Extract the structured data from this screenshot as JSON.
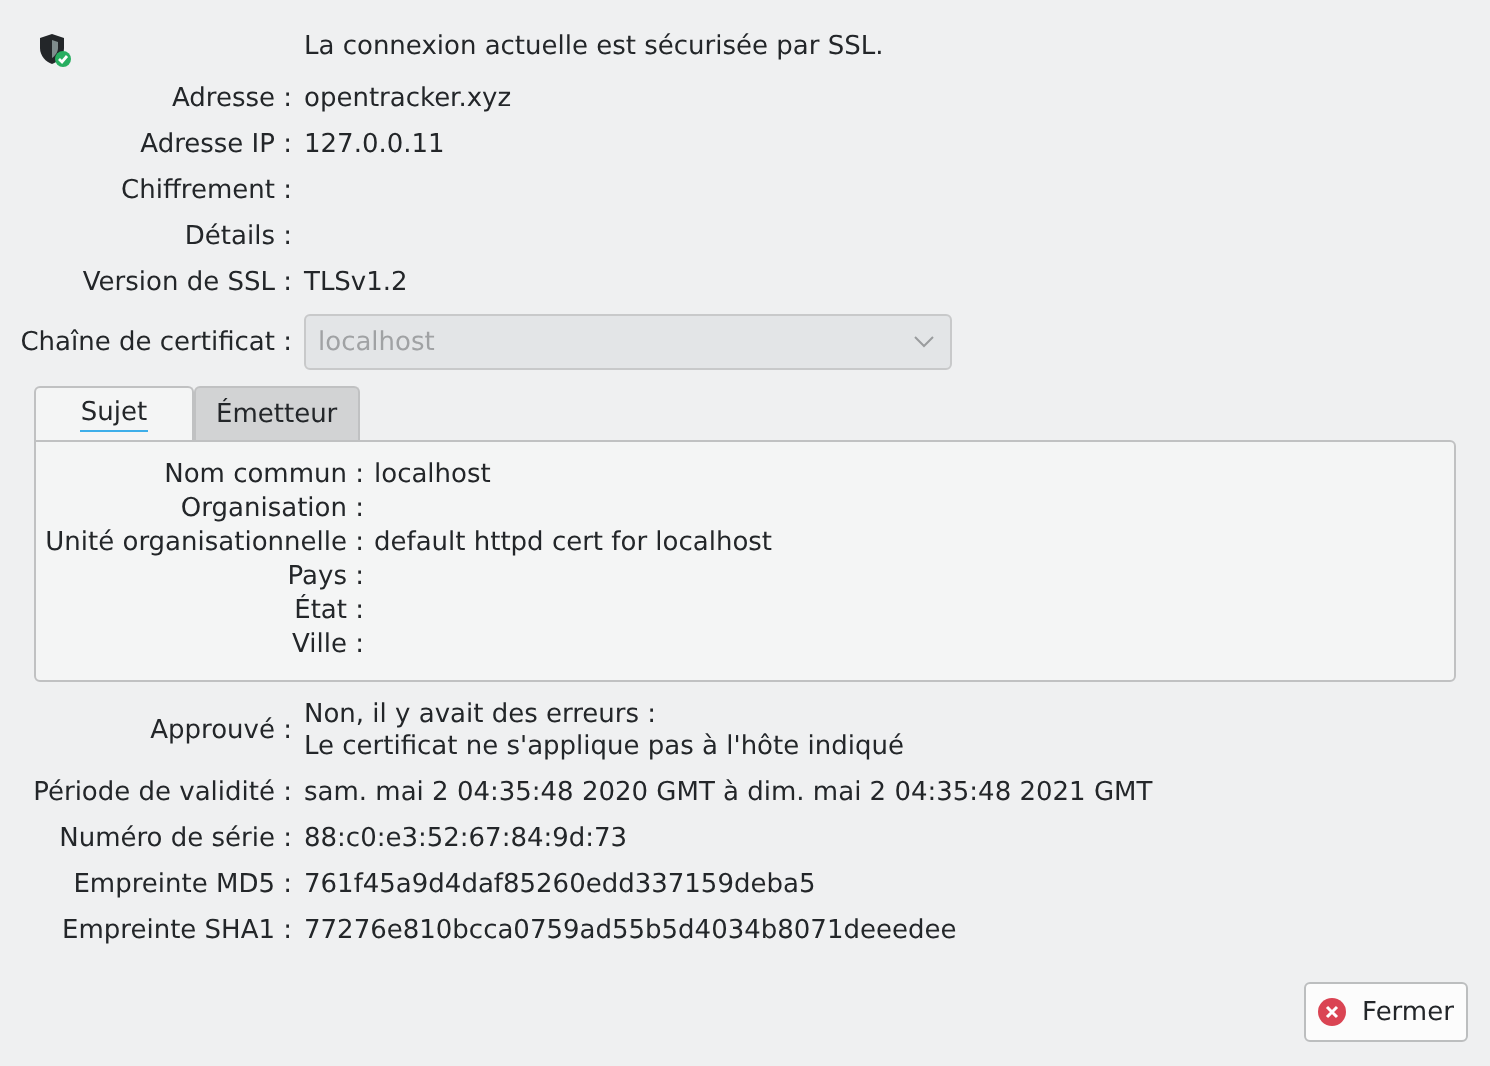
{
  "header": "La connexion actuelle est sécurisée par SSL.",
  "fields": [
    {
      "label": "Adresse :",
      "value": "opentracker.xyz"
    },
    {
      "label": "Adresse IP :",
      "value": "127.0.0.11"
    },
    {
      "label": "Chiffrement :"
    },
    {
      "label": "Détails :"
    },
    {
      "label": "Version de SSL :",
      "value": "TLSv1.2"
    }
  ],
  "chain": {
    "label": "Chaîne de certificat :",
    "value": "localhost",
    "disabled": true
  },
  "tabs": [
    {
      "label": "Sujet",
      "selected": true
    },
    {
      "label": "Émetteur",
      "selected": false
    }
  ],
  "subject": [
    {
      "label": "Nom commun :",
      "value": "localhost"
    },
    {
      "label": "Organisation :"
    },
    {
      "label": "Unité organisationnelle :",
      "value": "default httpd cert for localhost"
    },
    {
      "label": "Pays :"
    },
    {
      "label": "État :"
    },
    {
      "label": "Ville :"
    }
  ],
  "details": [
    {
      "label": "Approuvé :",
      "lines": [
        "Non, il y avait des erreurs :",
        "Le certificat ne s'applique pas à l'hôte indiqué"
      ]
    },
    {
      "label": "Période de validité :",
      "lines": [
        "sam. mai 2 04:35:48 2020 GMT à dim. mai 2 04:35:48 2021 GMT"
      ]
    },
    {
      "label": "Numéro de série :",
      "lines": [
        "88:c0:e3:52:67:84:9d:73"
      ]
    },
    {
      "label": "Empreinte MD5 :",
      "lines": [
        "761f45a9d4daf85260edd337159deba5"
      ]
    },
    {
      "label": "Empreinte SHA1 :",
      "lines": [
        "77276e810bcca0759ad55b5d4034b8071deeedee"
      ]
    }
  ],
  "close_button": "Fermer"
}
